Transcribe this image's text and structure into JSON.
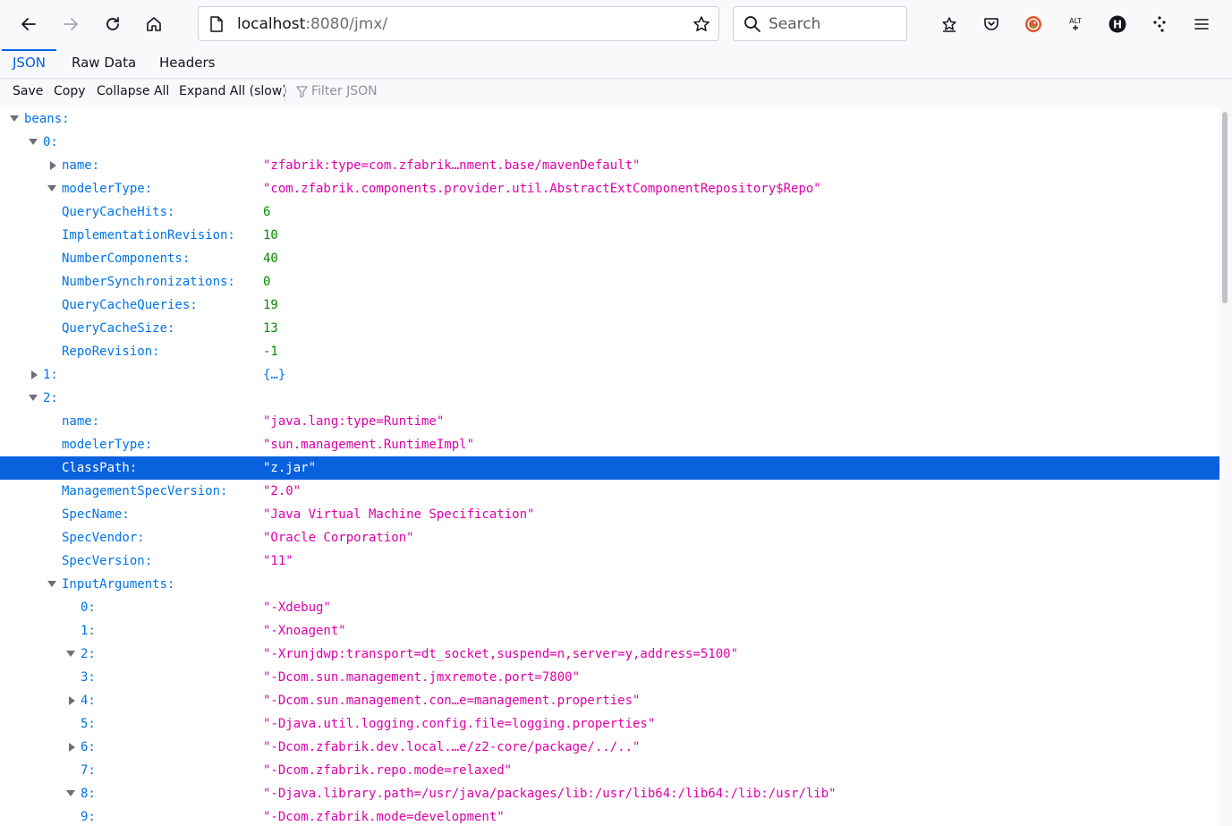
{
  "browser": {
    "url_host": "localhost",
    "url_rest": ":8080/jmx/",
    "search_placeholder": "Search"
  },
  "tabs": [
    {
      "label": "JSON",
      "active": true
    },
    {
      "label": "Raw Data",
      "active": false
    },
    {
      "label": "Headers",
      "active": false
    }
  ],
  "toolbar": {
    "save": "Save",
    "copy": "Copy",
    "collapse_all": "Collapse All",
    "expand_all": "Expand All (slow)",
    "filter_placeholder": "Filter JSON"
  },
  "rows": [
    {
      "key": "beans:",
      "indent": 0,
      "twisty": "open",
      "value": "",
      "type": ""
    },
    {
      "key": "0:",
      "indent": 1,
      "twisty": "open",
      "value": "",
      "type": ""
    },
    {
      "key": "name:",
      "indent": 2,
      "twisty": "closed",
      "value": "\"zfabrik:type=com.zfabrik…nment.base/mavenDefault\"",
      "type": "str"
    },
    {
      "key": "modelerType:",
      "indent": 2,
      "twisty": "open",
      "value": "\"com.zfabrik.components.provider.util.AbstractExtComponentRepository$Repo\"",
      "type": "str"
    },
    {
      "key": "QueryCacheHits:",
      "indent": 2,
      "twisty": "",
      "value": "6",
      "type": "num"
    },
    {
      "key": "ImplementationRevision:",
      "indent": 2,
      "twisty": "",
      "value": "10",
      "type": "num"
    },
    {
      "key": "NumberComponents:",
      "indent": 2,
      "twisty": "",
      "value": "40",
      "type": "num"
    },
    {
      "key": "NumberSynchronizations:",
      "indent": 2,
      "twisty": "",
      "value": "0",
      "type": "num"
    },
    {
      "key": "QueryCacheQueries:",
      "indent": 2,
      "twisty": "",
      "value": "19",
      "type": "num"
    },
    {
      "key": "QueryCacheSize:",
      "indent": 2,
      "twisty": "",
      "value": "13",
      "type": "num"
    },
    {
      "key": "RepoRevision:",
      "indent": 2,
      "twisty": "",
      "value": "-1",
      "type": "num"
    },
    {
      "key": "1:",
      "indent": 1,
      "twisty": "closed",
      "value": "{…}",
      "type": "obj"
    },
    {
      "key": "2:",
      "indent": 1,
      "twisty": "open",
      "value": "",
      "type": ""
    },
    {
      "key": "name:",
      "indent": 2,
      "twisty": "",
      "value": "\"java.lang:type=Runtime\"",
      "type": "str"
    },
    {
      "key": "modelerType:",
      "indent": 2,
      "twisty": "",
      "value": "\"sun.management.RuntimeImpl\"",
      "type": "str"
    },
    {
      "key": "ClassPath:",
      "indent": 2,
      "twisty": "",
      "value": "\"z.jar\"",
      "type": "str",
      "selected": true
    },
    {
      "key": "ManagementSpecVersion:",
      "indent": 2,
      "twisty": "",
      "value": "\"2.0\"",
      "type": "str"
    },
    {
      "key": "SpecName:",
      "indent": 2,
      "twisty": "",
      "value": "\"Java Virtual Machine Specification\"",
      "type": "str"
    },
    {
      "key": "SpecVendor:",
      "indent": 2,
      "twisty": "",
      "value": "\"Oracle Corporation\"",
      "type": "str"
    },
    {
      "key": "SpecVersion:",
      "indent": 2,
      "twisty": "",
      "value": "\"11\"",
      "type": "str"
    },
    {
      "key": "InputArguments:",
      "indent": 2,
      "twisty": "open",
      "value": "",
      "type": ""
    },
    {
      "key": "0:",
      "indent": 3,
      "twisty": "",
      "value": "\"-Xdebug\"",
      "type": "str"
    },
    {
      "key": "1:",
      "indent": 3,
      "twisty": "",
      "value": "\"-Xnoagent\"",
      "type": "str"
    },
    {
      "key": "2:",
      "indent": 3,
      "twisty": "open",
      "value": "\"-Xrunjdwp:transport=dt_socket,suspend=n,server=y,address=5100\"",
      "type": "str"
    },
    {
      "key": "3:",
      "indent": 3,
      "twisty": "",
      "value": "\"-Dcom.sun.management.jmxremote.port=7800\"",
      "type": "str"
    },
    {
      "key": "4:",
      "indent": 3,
      "twisty": "closed",
      "value": "\"-Dcom.sun.management.con…e=management.properties\"",
      "type": "str"
    },
    {
      "key": "5:",
      "indent": 3,
      "twisty": "",
      "value": "\"-Djava.util.logging.config.file=logging.properties\"",
      "type": "str"
    },
    {
      "key": "6:",
      "indent": 3,
      "twisty": "closed",
      "value": "\"-Dcom.zfabrik.dev.local.…e/z2-core/package/../..\"",
      "type": "str"
    },
    {
      "key": "7:",
      "indent": 3,
      "twisty": "",
      "value": "\"-Dcom.zfabrik.repo.mode=relaxed\"",
      "type": "str"
    },
    {
      "key": "8:",
      "indent": 3,
      "twisty": "open",
      "value": "\"-Djava.library.path=/usr/java/packages/lib:/usr/lib64:/lib64:/lib:/usr/lib\"",
      "type": "str"
    },
    {
      "key": "9:",
      "indent": 3,
      "twisty": "",
      "value": "\"-Dcom.zfabrik.mode=development\"",
      "type": "str"
    }
  ]
}
